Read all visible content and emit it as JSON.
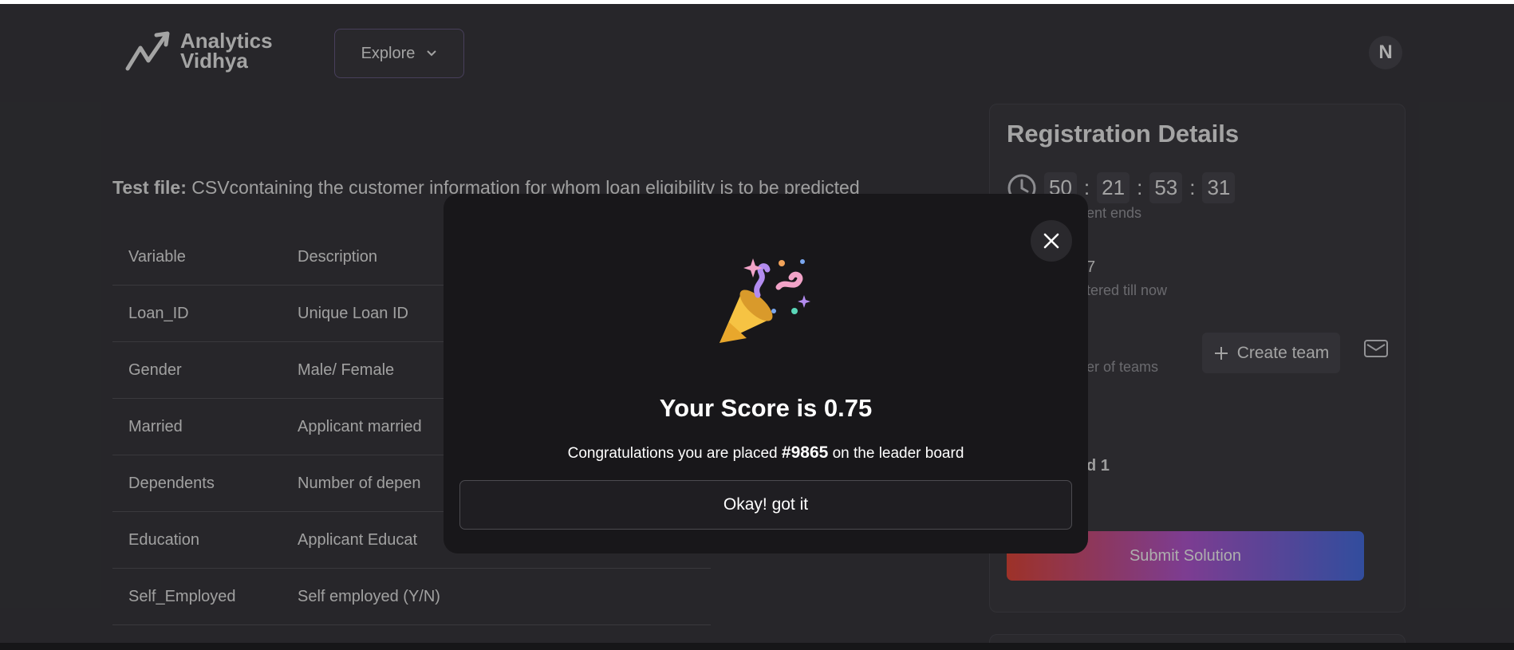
{
  "header": {
    "logo_line1": "Analytics",
    "logo_line2": "Vidhya",
    "explore_label": "Explore",
    "avatar_initial": "N"
  },
  "content": {
    "test_file_label": "Test file:",
    "test_file_text": " CSVcontaining the customer information for whom loan eligibility is to be predicted",
    "table": {
      "headers": [
        "Variable",
        "Description"
      ],
      "rows": [
        [
          "Loan_ID",
          "Unique Loan ID"
        ],
        [
          "Gender",
          "Male/ Female"
        ],
        [
          "Married",
          "Applicant married"
        ],
        [
          "Dependents",
          "Number of depen"
        ],
        [
          "Education",
          "Applicant Educat"
        ],
        [
          "Self_Employed",
          "Self employed (Y/N)"
        ]
      ]
    }
  },
  "registration": {
    "title": "Registration Details",
    "timer": [
      "50",
      "21",
      "53",
      "31"
    ],
    "event_ends_partial": "ent ends",
    "registered_count_partial": "7",
    "registered_partial": "tered till now",
    "teams_partial": "er of teams",
    "create_team_label": "Create team",
    "rank_partial": "d 1",
    "submit_label": "Submit Solution"
  },
  "modal": {
    "score_text": "Your Score is 0.75",
    "congrats_prefix": "Congratulations you are placed ",
    "rank": "#9865",
    "congrats_suffix": " on the leader board",
    "okay_label": "Okay! got it"
  },
  "colors": {
    "background": "#2b2a2e",
    "modal_bg": "#18171a",
    "submit_gradient": [
      "#e84a3c",
      "#b85ad6",
      "#4a72e8"
    ]
  }
}
